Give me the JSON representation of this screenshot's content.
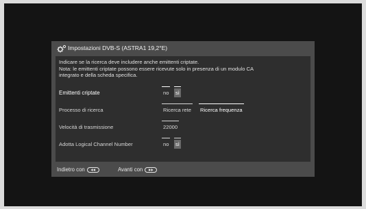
{
  "dialog": {
    "title": "Impostazioni DVB-S (ASTRA1 19,2°E)",
    "description": [
      "Indicare se la ricerca deve includere anche emittenti criptate.",
      "Nota: le emittenti criptate possono essere ricevute solo in presenza di un modulo CA",
      "integrato e della scheda specifica."
    ]
  },
  "settings": [
    {
      "label": "Emittenti criptate",
      "options": [
        "no",
        "sì"
      ],
      "selected": "sì"
    },
    {
      "label": "Processo di ricerca",
      "options": [
        "Ricerca rete",
        "Ricerca frequenza"
      ],
      "selected": "Ricerca frequenza"
    },
    {
      "label": "Velocità di trasmissione",
      "options": [
        "22000"
      ],
      "selected": "22000"
    },
    {
      "label": "Adotta Logical Channel Number",
      "options": [
        "no",
        "sì"
      ],
      "selected": "sì"
    }
  ],
  "footer": {
    "back_label": "Indietro con",
    "forward_label": "Avanti con",
    "back_icon": "rewind-key-icon",
    "forward_icon": "forward-key-icon"
  },
  "colors": {
    "frame": "#dcdcdc",
    "background": "#141414",
    "dialog": "#4b4b4b",
    "panel": "#2e2e2e",
    "selected": "#6a6a6a"
  }
}
